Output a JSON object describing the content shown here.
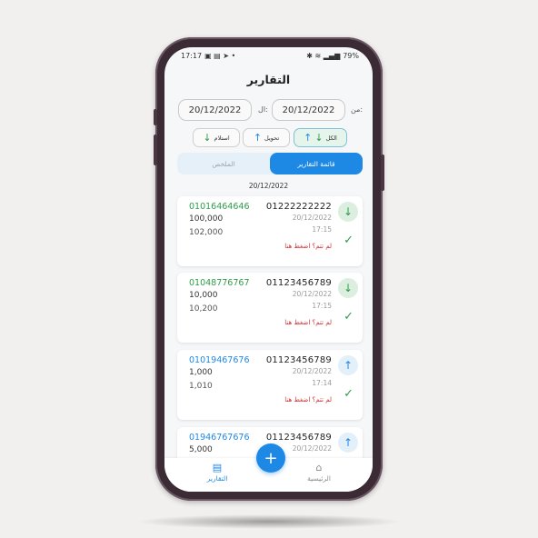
{
  "status_bar": {
    "time": "17:17",
    "battery": "79%"
  },
  "header": {
    "title": "التقارير"
  },
  "filters": {
    "from_label": "من:",
    "from_date": "20/12/2022",
    "to_label": "ال:",
    "to_date": "20/12/2022",
    "chips": [
      {
        "label": "الكل",
        "active": true
      },
      {
        "label": "تحويل",
        "active": false
      },
      {
        "label": "استلام",
        "active": false
      }
    ]
  },
  "tabs": {
    "active": "قائمة التقارير",
    "inactive": "الملخص"
  },
  "list": {
    "date_header": "20/12/2022",
    "items": [
      {
        "number": "01222222222",
        "date": "20/12/2022",
        "time": "17:15",
        "other_number": "01016464646",
        "amount": "100,000",
        "amount2": "102,000",
        "warning": "لم تتم؟ اضغط هنا",
        "direction": "receive",
        "color": "#2e9c4a"
      },
      {
        "number": "01123456789",
        "date": "20/12/2022",
        "time": "17:15",
        "other_number": "01048776767",
        "amount": "10,000",
        "amount2": "10,200",
        "warning": "لم تتم؟ اضغط هنا",
        "direction": "receive",
        "color": "#2e9c4a"
      },
      {
        "number": "01123456789",
        "date": "20/12/2022",
        "time": "17:14",
        "other_number": "01019467676",
        "amount": "1,000",
        "amount2": "1,010",
        "warning": "لم تتم؟ اضغط هنا",
        "direction": "send",
        "color": "#1e88e5"
      },
      {
        "number": "01123456789",
        "date": "20/12/2022",
        "other_number": "01946767676",
        "amount": "5,000",
        "direction": "send",
        "color": "#1e88e5"
      }
    ]
  },
  "bottom_nav": {
    "reports": {
      "label": "التقارير",
      "icon": "report-icon"
    },
    "home": {
      "label": "الرئيسية",
      "icon": "home-icon"
    },
    "fab": "+"
  }
}
